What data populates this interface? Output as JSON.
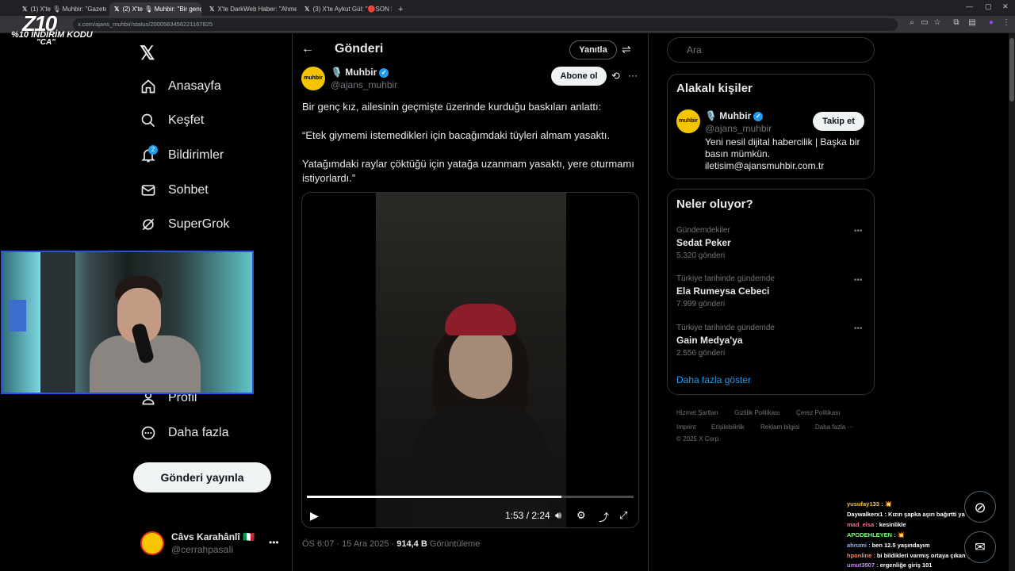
{
  "browser": {
    "tabs": [
      {
        "label": "(1) X'te 🎙 Muhbir: \"Gazeteci İs",
        "active": false
      },
      {
        "label": "(2) X'te 🎙 Muhbir: \"Bir genç kı",
        "active": true
      },
      {
        "label": "X'te DarkWeb Haber: \"Ahmet Ç",
        "active": false
      },
      {
        "label": "(3) X'te Aykut Gül: \"🔴SON DA",
        "active": false
      }
    ],
    "url": "x.com/ajans_muhbir/status/2000583456221167825"
  },
  "overlay": {
    "logo": "Z10",
    "promo_line1": "%10 İNDİRİM KODU",
    "promo_line2": "\"CA\""
  },
  "nav": {
    "logo": "𝕏",
    "items": [
      {
        "label": "Anasayfa",
        "icon": "home-icon"
      },
      {
        "label": "Keşfet",
        "icon": "search-icon"
      },
      {
        "label": "Bildirimler",
        "icon": "bell-icon",
        "badge": "2"
      },
      {
        "label": "Sohbet",
        "icon": "mail-icon"
      },
      {
        "label": "SuperGrok",
        "icon": "grok-icon"
      },
      {
        "label": "Profil",
        "icon": "profile-icon"
      },
      {
        "label": "Daha fazla",
        "icon": "more-circle-icon"
      }
    ],
    "post_button": "Gönderi yayınla",
    "account": {
      "name": "Câvs Karahânlî 🇮🇹",
      "handle": "@cerrahpasaIi"
    }
  },
  "post": {
    "header_title": "Gönderi",
    "reply_button": "Yanıtla",
    "author": {
      "name": "🎙️ Muhbir",
      "handle": "@ajans_muhbir",
      "avatar_text": "muhbir"
    },
    "subscribe_button": "Abone ol",
    "text": [
      "Bir genç kız, ailesinin geçmişte  üzerinde kurduğu baskıları anlattı:",
      "“Etek giymemi istemedikleri için bacağımdaki tüyleri almam yasaktı.",
      "Yatağımdaki raylar çöktüğü için yatağa uzanmam yasaktı, yere oturmamı istiyorlardı.”"
    ],
    "video": {
      "time": "1:53 / 2:24",
      "progress": 0.78
    },
    "time": "ÖS 6:07 · 15 Ara 2025 · ",
    "views": "914,4 B",
    "views_label": " Görüntüleme"
  },
  "sidebar": {
    "search_placeholder": "Ara",
    "related": {
      "title": "Alakalı kişiler",
      "name": "🎙️ Muhbir",
      "handle": "@ajans_muhbir",
      "follow_button": "Takip et",
      "bio": "Yeni nesil dijital habercilik | Başka bir basın mümkün. iletisim@ajansmuhbir.com.tr"
    },
    "trends": {
      "title": "Neler oluyor?",
      "items": [
        {
          "context": "Gündemdekiler",
          "name": "Sedat Peker",
          "count": "5.320 gönderi"
        },
        {
          "context": "Türkiye tarihinde gündemde",
          "name": "Ela Rumeysa Cebeci",
          "count": "7.999 gönderi"
        },
        {
          "context": "Türkiye tarihinde gündemde",
          "name": "Gain Medya'ya",
          "count": "2.556 gönderi"
        }
      ],
      "show_more": "Daha fazla göster"
    },
    "footer": {
      "row1": [
        "Hizmet Şartları",
        "Gizlilik Politikası",
        "Çerez Politikası"
      ],
      "row2": [
        "Imprint",
        "Erişilebilirlik",
        "Reklam bilgisi",
        "Daha fazla ···"
      ],
      "copyright": "© 2025 X Corp."
    }
  },
  "chat": [
    {
      "user": "yusufay133 :",
      "msg": "💥",
      "color": "#f5c542"
    },
    {
      "user": "Daywalkerx1 :",
      "msg": "Kızın şapka aşırı bağırtti ya",
      "color": "#ffffff"
    },
    {
      "user": "mad_elsa :",
      "msg": "kesinlikle",
      "color": "#ff6b8a"
    },
    {
      "user": "APODEHLEYEN :",
      "msg": "💥",
      "color": "#7fff7f"
    },
    {
      "user": "ahrumi :",
      "msg": "ben 12.5 yaşındayım",
      "color": "#8ab4f8"
    },
    {
      "user": "hponline :",
      "msg": "bi bildikleri varmış ortaya çıkan şeye bak",
      "color": "#ff8a65"
    },
    {
      "user": "umut3507 :",
      "msg": "ergenliğe giriş 101",
      "color": "#c58af9"
    }
  ]
}
